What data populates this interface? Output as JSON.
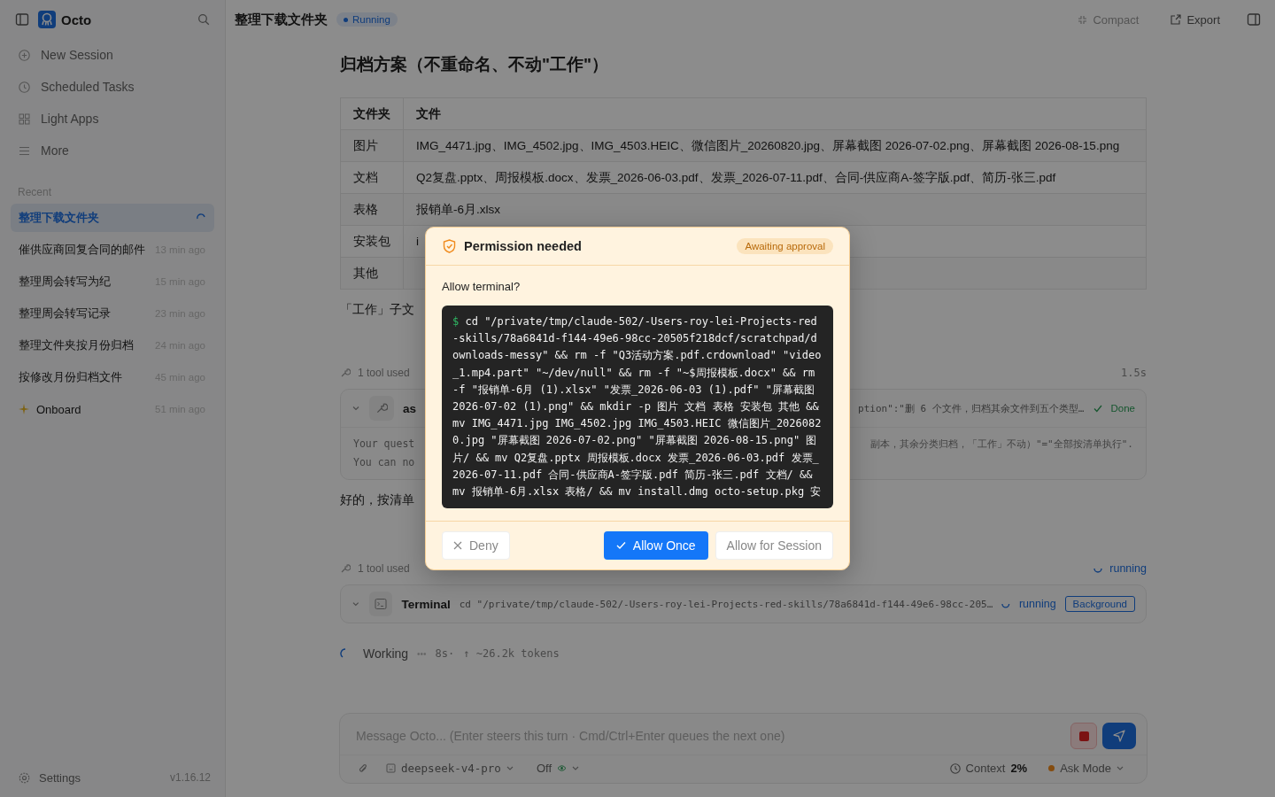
{
  "sidebar": {
    "app_name": "Octo",
    "nav": [
      {
        "label": "New Session"
      },
      {
        "label": "Scheduled Tasks"
      },
      {
        "label": "Light Apps"
      },
      {
        "label": "More"
      }
    ],
    "recent_heading": "Recent",
    "sessions": [
      {
        "title": "整理下载文件夹",
        "selected": true,
        "running": true,
        "kind": "task"
      },
      {
        "title": "催供应商回复合同的邮件",
        "time": "13 min ago",
        "selected": false,
        "running": false,
        "kind": "task"
      },
      {
        "title": "整理周会转写为纪",
        "time": "15 min ago",
        "selected": false,
        "running": false,
        "kind": "task"
      },
      {
        "title": "整理周会转写记录",
        "time": "23 min ago",
        "selected": false,
        "running": false,
        "kind": "task"
      },
      {
        "title": "整理文件夹按月份归档",
        "time": "24 min ago",
        "selected": false,
        "running": false,
        "kind": "task"
      },
      {
        "title": "按修改月份归档文件",
        "time": "45 min ago",
        "selected": false,
        "running": false,
        "kind": "task"
      },
      {
        "title": "Onboard",
        "time": "51 min ago",
        "selected": false,
        "running": false,
        "kind": "onboard"
      }
    ],
    "settings": "Settings",
    "version": "v1.16.12"
  },
  "header": {
    "title": "整理下载文件夹",
    "status": "Running",
    "actions": [
      {
        "label": "Compact",
        "disabled": true
      },
      {
        "label": "Export",
        "disabled": false
      }
    ]
  },
  "content": {
    "heading": "归档方案（不重命名、不动\"工作\"）",
    "table": {
      "columns": [
        "文件夹",
        "文件"
      ],
      "rows": [
        [
          "图片",
          "IMG_4471.jpg、IMG_4502.jpg、IMG_4503.HEIC、微信图片_20260820.jpg、屏幕截图 2026-07-02.png、屏幕截图 2026-08-15.png"
        ],
        [
          "文档",
          "Q2复盘.pptx、周报模板.docx、发票_2026-06-03.pdf、发票_2026-07-11.pdf、合同-供应商A-签字版.pdf、简历-张三.pdf"
        ],
        [
          "表格",
          "报销单-6月.xlsx"
        ],
        [
          "安装包",
          "i"
        ],
        [
          "其他",
          ""
        ]
      ]
    },
    "note_fragment": "「工作」子文",
    "tool_group_1": {
      "label": "1 tool used",
      "duration": "1.5s",
      "name": "as",
      "summary": "ption\":\"删 6 个文件，归档其余文件到五个类型…",
      "status": "Done",
      "result_lines": [
        {
          "left": "Your quest",
          "right": "副本，其余分类归档，「工作」不动）\"=\"全部按清单执行\"."
        },
        {
          "left": "You can no"
        }
      ]
    },
    "reply_fragment": "好的，按清单",
    "tool_group_2": {
      "label": "1 tool used",
      "status": "running",
      "name": "Terminal",
      "command": "cd \"/private/tmp/claude-502/-Users-roy-lei-Projects-red-skills/78a6841d-f144-49e6-98cc-205…",
      "row_status": "running",
      "badge": "Background"
    },
    "working": {
      "label": "Working",
      "dots": "•••",
      "elapsed": "8s·",
      "tokens": "↑ ~26.2k tokens"
    }
  },
  "composer": {
    "placeholder": "Message Octo... (Enter steers this turn · Cmd/Ctrl+Enter queues the next one)",
    "model": "deepseek-v4-pro",
    "thinking": "Off",
    "context_label": "Context",
    "context_value": "2%",
    "mode": "Ask Mode"
  },
  "dialog": {
    "title": "Permission needed",
    "badge": "Awaiting approval",
    "question": "Allow terminal?",
    "prompt": "$",
    "command": "cd \"/private/tmp/claude-502/-Users-roy-lei-Projects-red-skills/78a6841d-f144-49e6-98cc-20505f218dcf/scratchpad/downloads-messy\" && rm -f \"Q3活动方案.pdf.crdownload\" \"video_1.mp4.part\" \"~/dev/null\" && rm -f \"~$周报模板.docx\" && rm -f \"报销单-6月 (1).xlsx\" \"发票_2026-06-03 (1).pdf\" \"屏幕截图 2026-07-02 (1).png\" && mkdir -p 图片 文档 表格 安装包 其他 && mv IMG_4471.jpg IMG_4502.jpg IMG_4503.HEIC 微信图片_20260820.jpg \"屏幕截图 2026-07-02.png\" \"屏幕截图 2026-08-15.png\" 图片/ && mv Q2复盘.pptx 周报模板.docx 发票_2026-06-03.pdf 发票_2026-07-11.pdf 合同-供应商A-签字版.pdf 简历-张三.pdf 文档/ && mv 报销单-6月.xlsx 表格/ && mv install.dmg octo-setup.pkg 安",
    "buttons": [
      {
        "label": "Deny",
        "kind": "deny"
      },
      {
        "label": "Allow Once",
        "kind": "primary"
      },
      {
        "label": "Allow for Session",
        "kind": "secondary"
      }
    ]
  }
}
